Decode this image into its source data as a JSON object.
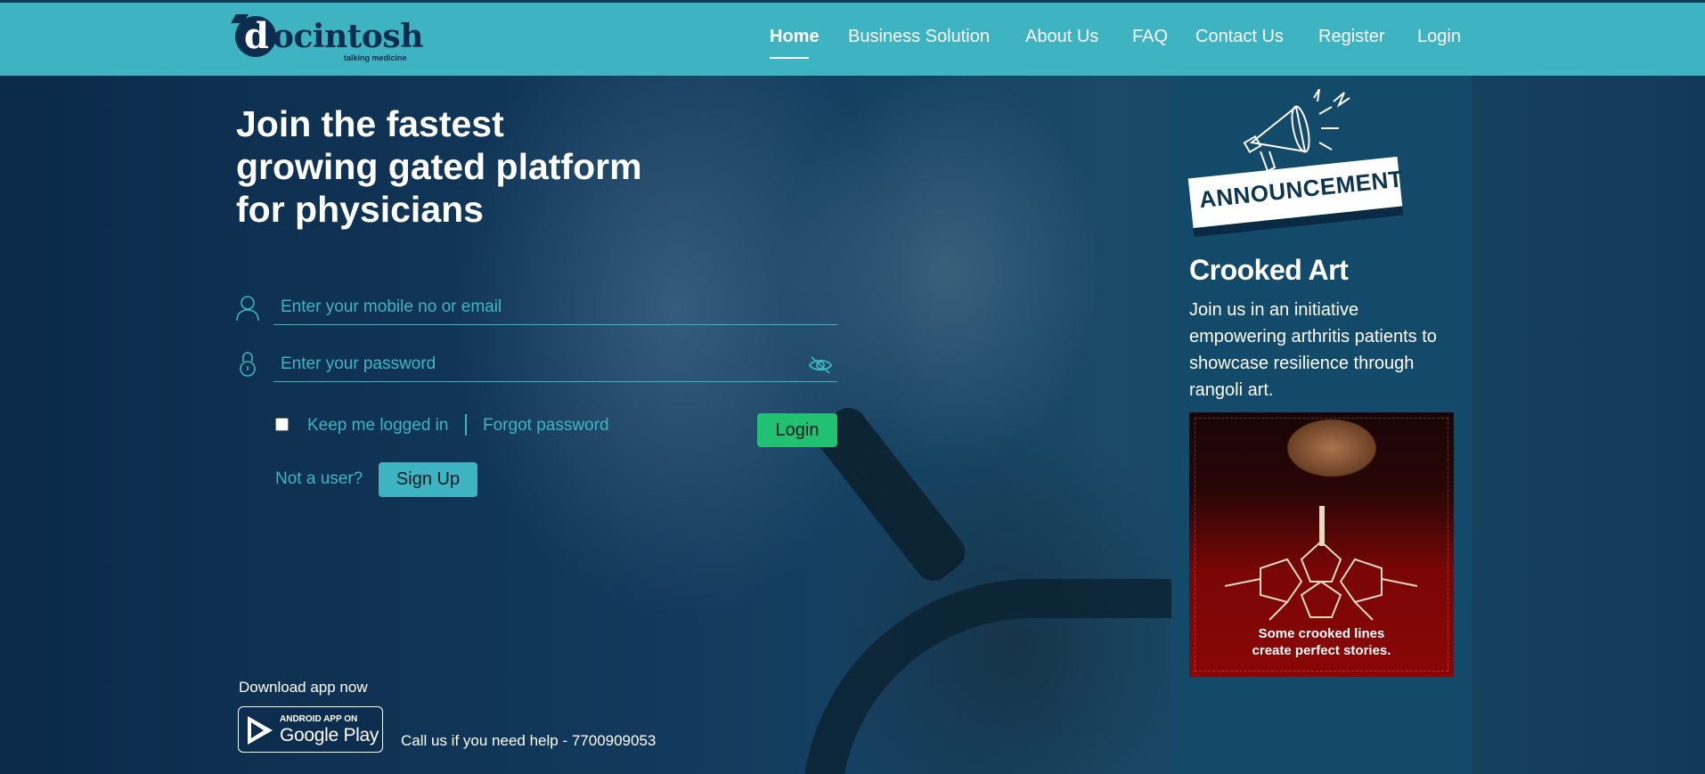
{
  "brand": {
    "name": "ocintosh",
    "initial": "d",
    "tagline": "talking medicine"
  },
  "nav": [
    {
      "label": "Home",
      "active": true
    },
    {
      "label": "Business Solution"
    },
    {
      "label": "About Us"
    },
    {
      "label": "FAQ"
    },
    {
      "label": "Contact Us"
    },
    {
      "label": "Register"
    },
    {
      "label": "Login"
    }
  ],
  "hero": {
    "headline_lines": [
      "Join the fastest",
      "growing gated platform",
      "for physicians"
    ]
  },
  "login_form": {
    "user_placeholder": "Enter your mobile no or email",
    "password_placeholder": "Enter your password",
    "keep_logged_in": "Keep me logged in",
    "keep_logged_in_checked": false,
    "forgot_password": "Forgot password",
    "login_button": "Login",
    "not_user": "Not a user?",
    "signup_button": "Sign Up"
  },
  "footer": {
    "download_label": "Download app now",
    "store_badge_top": "ANDROID APP ON",
    "store_badge_main": "Google Play",
    "help_text": "Call us if you need help - 7700909053"
  },
  "announcement": {
    "banner": "ANNOUNCEMENT",
    "title": "Crooked Art",
    "body": "Join us in an initiative empowering arthritis patients to showcase resilience through rangoli art.",
    "poster_caption_1": "Some crooked lines",
    "poster_caption_2": "create perfect stories."
  },
  "icons": {
    "user": "user-icon",
    "lock": "lock-icon",
    "eye": "eye-off-icon",
    "megaphone": "megaphone-icon",
    "play": "google-play-icon"
  },
  "colors": {
    "header": "#3eb3c2",
    "accent": "#3eb3c2",
    "login_button": "#22c172",
    "background": "#0d2d4f",
    "panel": "#134a6a"
  }
}
